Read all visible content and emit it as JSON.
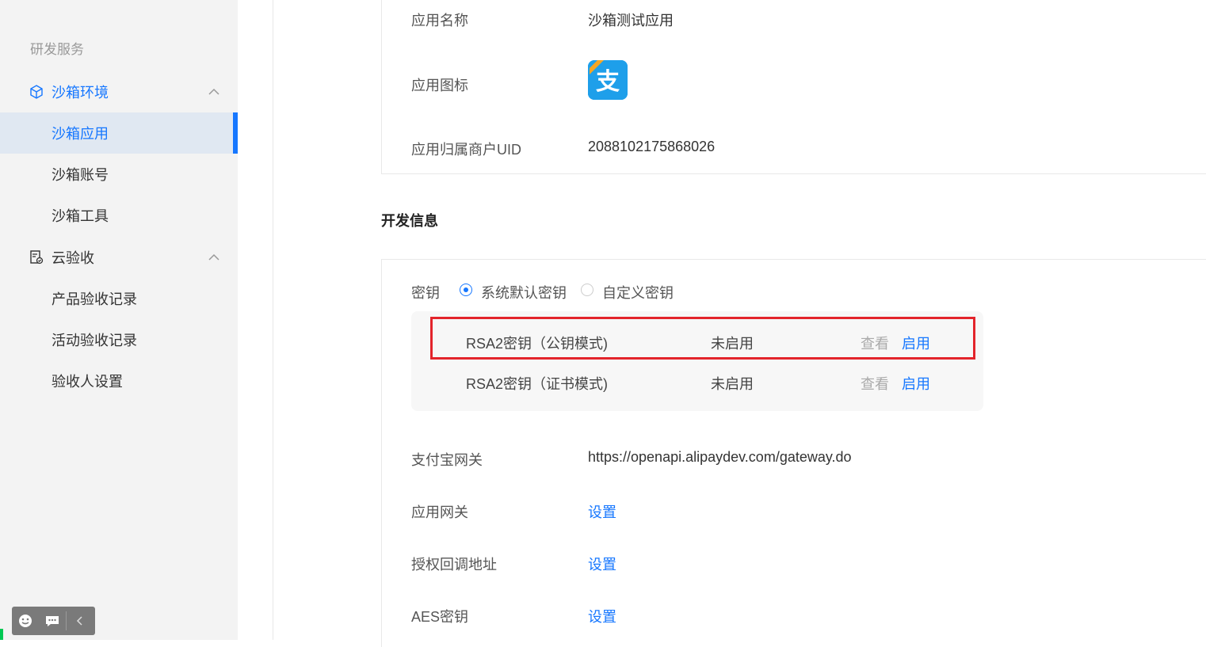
{
  "sidebar": {
    "section_title": "研发服务",
    "groups": [
      {
        "label": "沙箱环境",
        "icon": "cube-icon",
        "items": [
          {
            "label": "沙箱应用",
            "selected": true
          },
          {
            "label": "沙箱账号"
          },
          {
            "label": "沙箱工具"
          }
        ]
      },
      {
        "label": "云验收",
        "icon": "document-check-icon",
        "items": [
          {
            "label": "产品验收记录"
          },
          {
            "label": "活动验收记录"
          },
          {
            "label": "验收人设置"
          }
        ]
      }
    ]
  },
  "app_info": {
    "name_label": "应用名称",
    "name_value": "沙箱测试应用",
    "icon_label": "应用图标",
    "icon_glyph": "支",
    "uid_label": "应用归属商户UID",
    "uid_value": "2088102175868026"
  },
  "dev_info": {
    "title": "开发信息",
    "key_label": "密钥",
    "key_options": [
      "系统默认密钥",
      "自定义密钥"
    ],
    "key_rows": [
      {
        "name": "RSA2密钥（公钥模式)",
        "status": "未启用",
        "view": "查看",
        "enable": "启用"
      },
      {
        "name": "RSA2密钥（证书模式)",
        "status": "未启用",
        "view": "查看",
        "enable": "启用"
      }
    ],
    "gateway_label": "支付宝网关",
    "gateway_value": "https://openapi.alipaydev.com/gateway.do",
    "app_gateway_label": "应用网关",
    "auth_callback_label": "授权回调地址",
    "aes_label": "AES密钥",
    "set_link": "设置"
  },
  "colors": {
    "accent": "#1677ff",
    "highlight": "#e3242b",
    "sidebar_bg": "#f3f3f3",
    "alipay_blue": "#1e9fea"
  }
}
